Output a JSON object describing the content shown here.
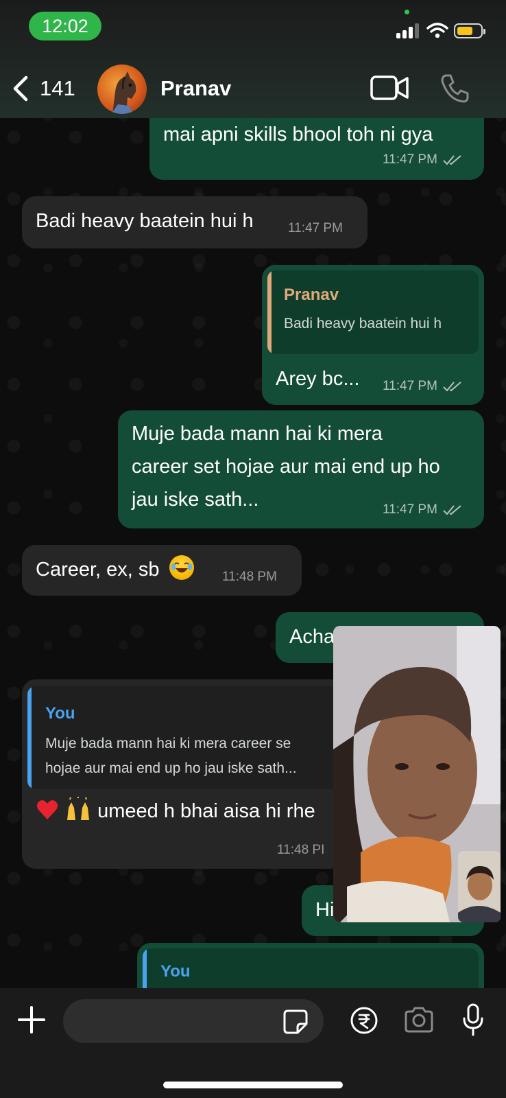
{
  "status_bar": {
    "time": "12:02"
  },
  "header": {
    "back_count": "141",
    "contact_name": "Pranav"
  },
  "messages": [
    {
      "text": "mai apni skills bhool toh ni gya",
      "time": "11:47 PM"
    },
    {
      "text": "Badi heavy baatein hui h",
      "time": "11:47 PM"
    },
    {
      "quote_author": "Pranav",
      "quote_text": "Badi heavy baatein hui h",
      "text": "Arey bc...",
      "time": "11:47 PM"
    },
    {
      "lines": [
        "Muje bada mann hai ki mera",
        "career set hojae aur mai end up ho",
        "jau iske sath..."
      ],
      "time": "11:47 PM"
    },
    {
      "text": "Career, ex, sb",
      "time": "11:48 PM"
    },
    {
      "text": "Acha"
    },
    {
      "quote_author": "You",
      "quote_lines": [
        "Muje bada mann hai ki mera career se",
        "hojae aur mai end up ho jau iske sath..."
      ],
      "text": "umeed h bhai aisa hi rhe",
      "time": "11:48 PI"
    },
    {
      "text": "Hi"
    },
    {
      "quote_author": "You"
    }
  ],
  "colors": {
    "outgoing_bubble": "#134d37",
    "incoming_bubble": "#262626",
    "quote_author_pranav": "#e0a979",
    "quote_author_you": "#4aa3f0",
    "status_pill": "#30b54a"
  },
  "icons": {
    "back": "chevron-left-icon",
    "video": "video-camera-icon",
    "call": "phone-icon",
    "attach": "plus-icon",
    "sticker": "sticker-icon",
    "payment": "rupee-icon",
    "camera": "camera-icon",
    "mic": "microphone-icon"
  }
}
